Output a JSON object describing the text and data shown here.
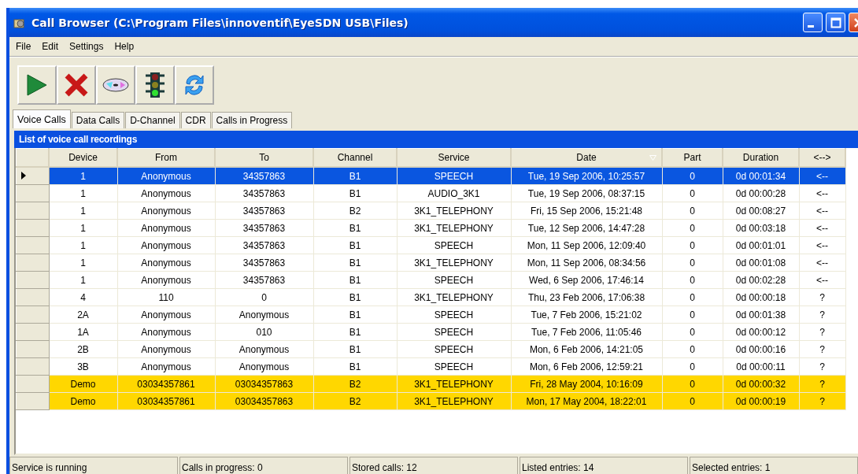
{
  "window": {
    "title": "Call Browser (C:\\Program Files\\innoventif\\EyeSDN USB\\Files)"
  },
  "menu": [
    {
      "label": "File"
    },
    {
      "label": "Edit"
    },
    {
      "label": "Settings"
    },
    {
      "label": "Help"
    }
  ],
  "toolbar": [
    {
      "kind": "play"
    },
    {
      "kind": "delete"
    },
    {
      "kind": "disc"
    },
    {
      "kind": "traffic-light"
    },
    {
      "kind": "refresh"
    }
  ],
  "tabs": [
    {
      "label": "Voice Calls",
      "selected": true
    },
    {
      "label": "Data Calls",
      "selected": false
    },
    {
      "label": "D-Channel",
      "selected": false
    },
    {
      "label": "CDR",
      "selected": false
    },
    {
      "label": "Calls in Progress",
      "selected": false
    }
  ],
  "panel_title": "List of voice call recordings",
  "table": {
    "columns": [
      {
        "label": "Device",
        "sorted": false
      },
      {
        "label": "From",
        "sorted": false
      },
      {
        "label": "To",
        "sorted": false
      },
      {
        "label": "Channel",
        "sorted": false
      },
      {
        "label": "Service",
        "sorted": false
      },
      {
        "label": "Date",
        "sorted": true
      },
      {
        "label": "Part",
        "sorted": false
      },
      {
        "label": "Duration",
        "sorted": false
      },
      {
        "label": "<-->",
        "sorted": false
      }
    ],
    "rows": [
      {
        "selected": true,
        "highlighted": false,
        "cells": [
          "1",
          "Anonymous",
          "34357863",
          "B1",
          "SPEECH",
          "Tue, 19 Sep 2006, 10:25:57",
          "0",
          "0d 00:01:34",
          "<--"
        ]
      },
      {
        "selected": false,
        "highlighted": false,
        "cells": [
          "1",
          "Anonymous",
          "34357863",
          "B1",
          "AUDIO_3K1",
          "Tue, 19 Sep 2006, 08:37:15",
          "0",
          "0d 00:00:28",
          "<--"
        ]
      },
      {
        "selected": false,
        "highlighted": false,
        "cells": [
          "1",
          "Anonymous",
          "34357863",
          "B2",
          "3K1_TELEPHONY",
          "Fri, 15 Sep 2006, 15:21:48",
          "0",
          "0d 00:08:27",
          "<--"
        ]
      },
      {
        "selected": false,
        "highlighted": false,
        "cells": [
          "1",
          "Anonymous",
          "34357863",
          "B1",
          "3K1_TELEPHONY",
          "Tue, 12 Sep 2006, 14:47:28",
          "0",
          "0d 00:03:18",
          "<--"
        ]
      },
      {
        "selected": false,
        "highlighted": false,
        "cells": [
          "1",
          "Anonymous",
          "34357863",
          "B1",
          "SPEECH",
          "Mon, 11 Sep 2006, 12:09:40",
          "0",
          "0d 00:01:01",
          "<--"
        ]
      },
      {
        "selected": false,
        "highlighted": false,
        "cells": [
          "1",
          "Anonymous",
          "34357863",
          "B1",
          "3K1_TELEPHONY",
          "Mon, 11 Sep 2006, 08:34:56",
          "0",
          "0d 00:01:08",
          "<--"
        ]
      },
      {
        "selected": false,
        "highlighted": false,
        "cells": [
          "1",
          "Anonymous",
          "34357863",
          "B1",
          "SPEECH",
          "Wed, 6 Sep 2006, 17:46:14",
          "0",
          "0d 00:02:28",
          "<--"
        ]
      },
      {
        "selected": false,
        "highlighted": false,
        "cells": [
          "4",
          "110",
          "0",
          "B1",
          "3K1_TELEPHONY",
          "Thu, 23 Feb 2006, 17:06:38",
          "0",
          "0d 00:00:18",
          "?"
        ]
      },
      {
        "selected": false,
        "highlighted": false,
        "cells": [
          "2A",
          "Anonymous",
          "Anonymous",
          "B1",
          "SPEECH",
          "Tue, 7 Feb 2006, 15:21:02",
          "0",
          "0d 00:01:38",
          "?"
        ]
      },
      {
        "selected": false,
        "highlighted": false,
        "cells": [
          "1A",
          "Anonymous",
          "010",
          "B1",
          "SPEECH",
          "Tue, 7 Feb 2006, 11:05:46",
          "0",
          "0d 00:00:12",
          "?"
        ]
      },
      {
        "selected": false,
        "highlighted": false,
        "cells": [
          "2B",
          "Anonymous",
          "Anonymous",
          "B1",
          "SPEECH",
          "Mon, 6 Feb 2006, 14:21:05",
          "0",
          "0d 00:00:16",
          "?"
        ]
      },
      {
        "selected": false,
        "highlighted": false,
        "cells": [
          "3B",
          "Anonymous",
          "Anonymous",
          "B1",
          "SPEECH",
          "Mon, 6 Feb 2006, 12:59:21",
          "0",
          "0d 00:00:11",
          "?"
        ]
      },
      {
        "selected": false,
        "highlighted": true,
        "cells": [
          "Demo",
          "03034357861",
          "03034357863",
          "B2",
          "3K1_TELEPHONY",
          "Fri, 28 May 2004, 10:16:09",
          "0",
          "0d 00:00:32",
          "?"
        ]
      },
      {
        "selected": false,
        "highlighted": true,
        "cells": [
          "Demo",
          "03034357861",
          "03034357863",
          "B2",
          "3K1_TELEPHONY",
          "Mon, 17 May 2004, 18:22:01",
          "0",
          "0d 00:00:19",
          "?"
        ]
      }
    ]
  },
  "status_bar": [
    "Service is running",
    "Calls in progress: 0",
    "Stored calls: 12",
    "Listed entries: 14",
    "Selected entries: 1"
  ]
}
